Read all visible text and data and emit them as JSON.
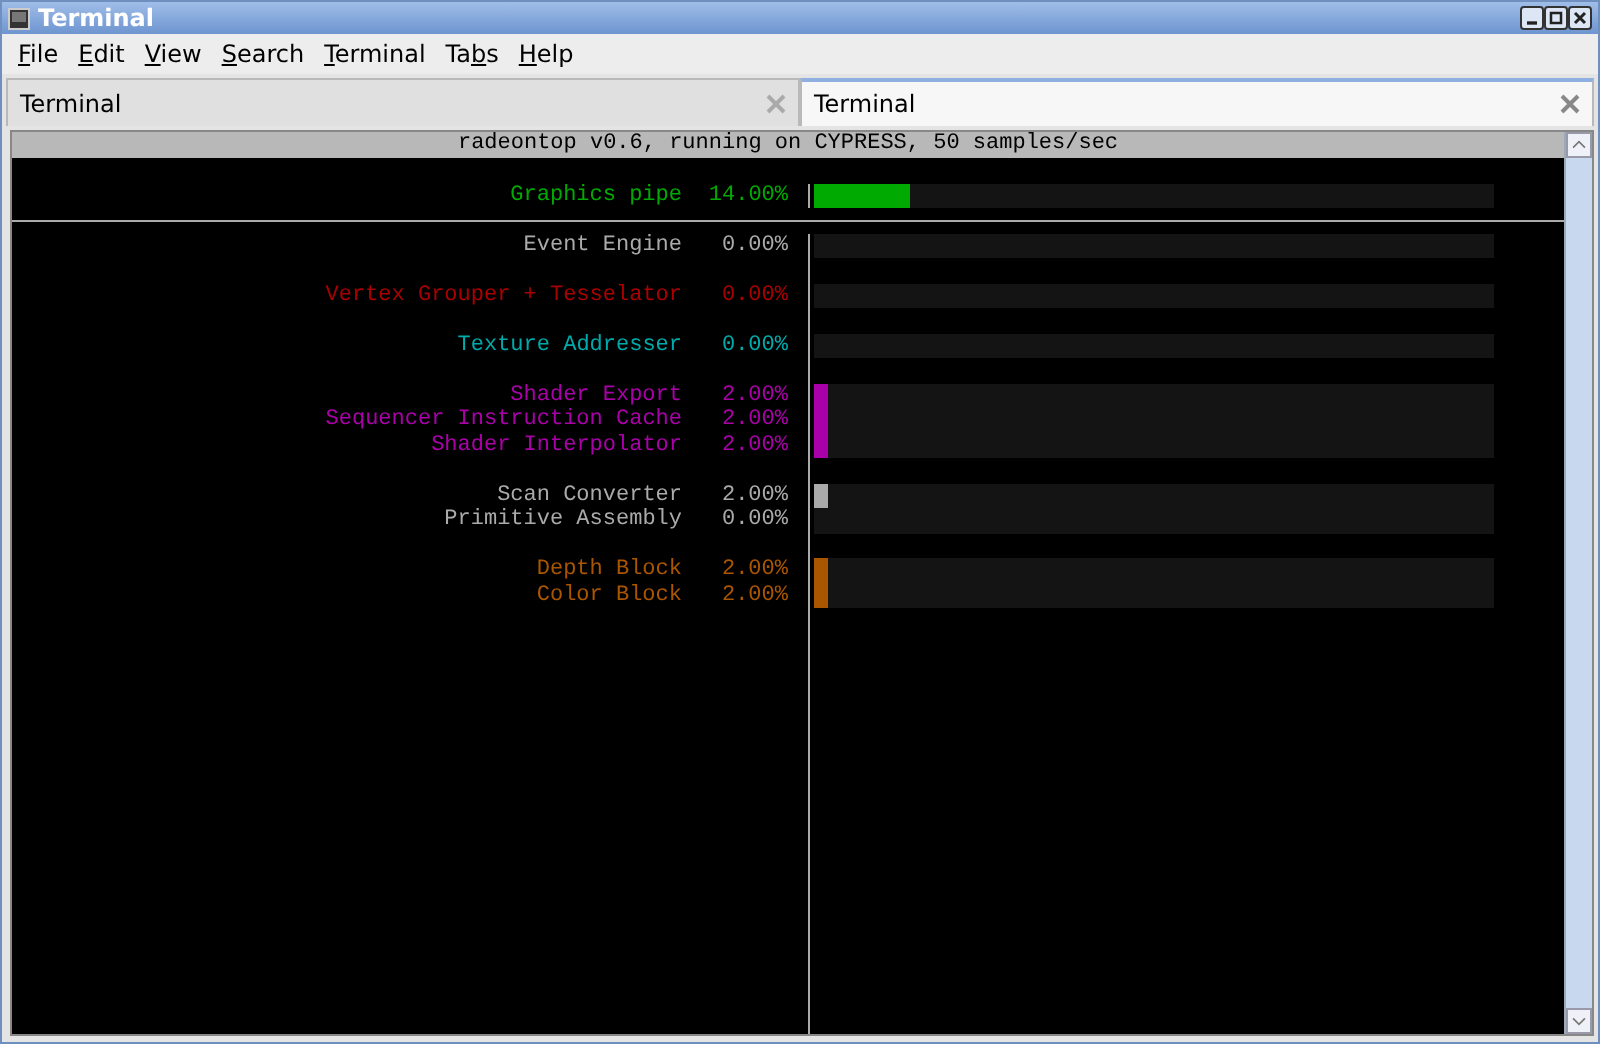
{
  "window": {
    "title": "Terminal"
  },
  "menu": [
    {
      "key": "F",
      "rest": "ile"
    },
    {
      "key": "E",
      "rest": "dit"
    },
    {
      "key": "V",
      "rest": "iew"
    },
    {
      "key": "S",
      "rest": "earch"
    },
    {
      "key": "T",
      "rest": "erminal"
    },
    {
      "lead": "Ta",
      "key": "b",
      "rest": "s"
    },
    {
      "key": "H",
      "rest": "elp"
    }
  ],
  "tabs": [
    {
      "label": "Terminal",
      "selected": false
    },
    {
      "label": "Terminal",
      "selected": true
    }
  ],
  "terminal": {
    "header": "radeontop v0.6, running on CYPRESS, 50 samples/sec",
    "summary": {
      "label": "Graphics pipe",
      "reading": "14.00%",
      "level": 0.14,
      "color": "#00aa00"
    },
    "groups": [
      {
        "rows": [
          {
            "label": "Event Engine",
            "reading": "0.00%",
            "level": 0,
            "color": "#aaaaaa"
          }
        ]
      },
      {
        "rows": [
          {
            "label": "Vertex Grouper + Tesselator",
            "reading": "0.00%",
            "level": 0,
            "color": "#aa0000"
          }
        ]
      },
      {
        "rows": [
          {
            "label": "Texture Addresser",
            "reading": "0.00%",
            "level": 0,
            "color": "#00aaaa"
          }
        ]
      },
      {
        "rows": [
          {
            "label": "Shader Export",
            "reading": "2.00%",
            "level": 0.02,
            "color": "#aa00aa"
          },
          {
            "label": "Sequencer Instruction Cache",
            "reading": "2.00%",
            "level": 0.02,
            "color": "#aa00aa"
          },
          {
            "label": "Shader Interpolator",
            "reading": "2.00%",
            "level": 0.02,
            "color": "#aa00aa"
          }
        ]
      },
      {
        "rows": [
          {
            "label": "Scan Converter",
            "reading": "2.00%",
            "level": 0.02,
            "color": "#aaaaaa"
          },
          {
            "label": "Primitive Assembly",
            "reading": "0.00%",
            "level": 0,
            "color": "#aaaaaa"
          }
        ]
      },
      {
        "rows": [
          {
            "label": "Depth Block",
            "reading": "2.00%",
            "level": 0.02,
            "color": "#aa5500"
          },
          {
            "label": "Color Block",
            "reading": "2.00%",
            "level": 0.02,
            "color": "#aa5500"
          }
        ]
      }
    ]
  }
}
